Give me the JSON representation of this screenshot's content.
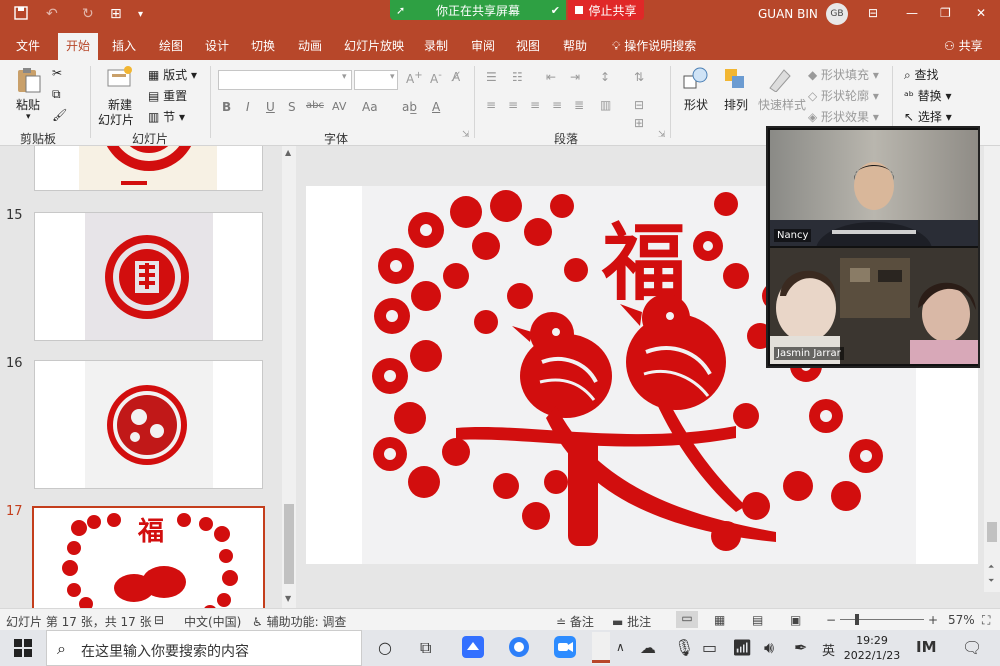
{
  "titlebar": {
    "sharing_banner": "你正在共享屏幕",
    "stop_share": "停止共享",
    "user_name": "GUAN BIN",
    "user_initials": "GB"
  },
  "tabs": [
    "文件",
    "开始",
    "插入",
    "绘图",
    "设计",
    "切换",
    "动画",
    "幻灯片放映",
    "录制",
    "审阅",
    "视图",
    "帮助"
  ],
  "tell_me": "操作说明搜索",
  "share_button": "共享",
  "ribbon": {
    "clipboard": {
      "paste": "粘贴",
      "group": "剪贴板"
    },
    "slides": {
      "new_slide": "新建",
      "new_slide2": "幻灯片",
      "layout": "版式",
      "reset": "重置",
      "section": "节",
      "group": "幻灯片"
    },
    "font": {
      "group": "字体",
      "bold": "B",
      "italic": "I",
      "underline": "U",
      "strike": "S",
      "abc": "abc",
      "av": "AV",
      "aa": "Aa",
      "a": "A"
    },
    "paragraph": {
      "group": "段落"
    },
    "drawing": {
      "shapes": "形状",
      "arrange": "排列",
      "quick_styles": "快速样式",
      "fill": "形状填充",
      "outline": "形状轮廓",
      "effects": "形状效果"
    },
    "editing": {
      "find": "查找",
      "replace": "替换",
      "select": "选择"
    }
  },
  "thumbnails": [
    {
      "num": "15"
    },
    {
      "num": "16"
    },
    {
      "num": "17"
    }
  ],
  "video": {
    "tile1_name": "Nancy",
    "tile2_name": "Jasmin Jarrar"
  },
  "statusbar": {
    "slide_info": "幻灯片 第 17 张，共 17 张",
    "language": "中文(中国)",
    "accessibility": "辅助功能: 调查",
    "notes": "备注",
    "comments": "批注",
    "zoom": "57%"
  },
  "taskbar": {
    "search_placeholder": "在这里输入你要搜索的内容",
    "ime": "英",
    "time": "19:29",
    "date": "2022/1/23"
  },
  "colors": {
    "accent": "#b7472a",
    "papercut_red": "#d20e0e",
    "share_green": "#2ea043",
    "stop_red": "#e02828"
  }
}
